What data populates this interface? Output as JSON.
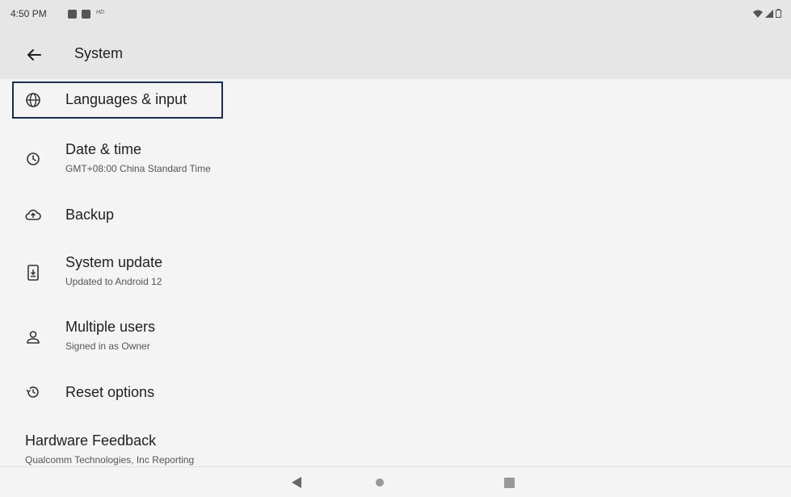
{
  "status": {
    "time": "4:50 PM",
    "hd": "HD"
  },
  "header": {
    "title": "System"
  },
  "items": [
    {
      "title": "Languages & input",
      "subtitle": "",
      "icon": "globe-icon"
    },
    {
      "title": "Date & time",
      "subtitle": "GMT+08:00 China Standard Time",
      "icon": "clock-icon"
    },
    {
      "title": "Backup",
      "subtitle": "",
      "icon": "cloud-upload-icon"
    },
    {
      "title": "System update",
      "subtitle": "Updated to Android 12",
      "icon": "system-update-icon"
    },
    {
      "title": "Multiple users",
      "subtitle": "Signed in as Owner",
      "icon": "person-icon"
    },
    {
      "title": "Reset options",
      "subtitle": "",
      "icon": "history-icon"
    },
    {
      "title": "Hardware Feedback",
      "subtitle": "Qualcomm Technologies, Inc Reporting",
      "icon": ""
    }
  ],
  "colors": {
    "highlight_border": "#1c2d4f",
    "header_bg": "#e6e6e6",
    "content_bg": "#f4f4f4"
  }
}
